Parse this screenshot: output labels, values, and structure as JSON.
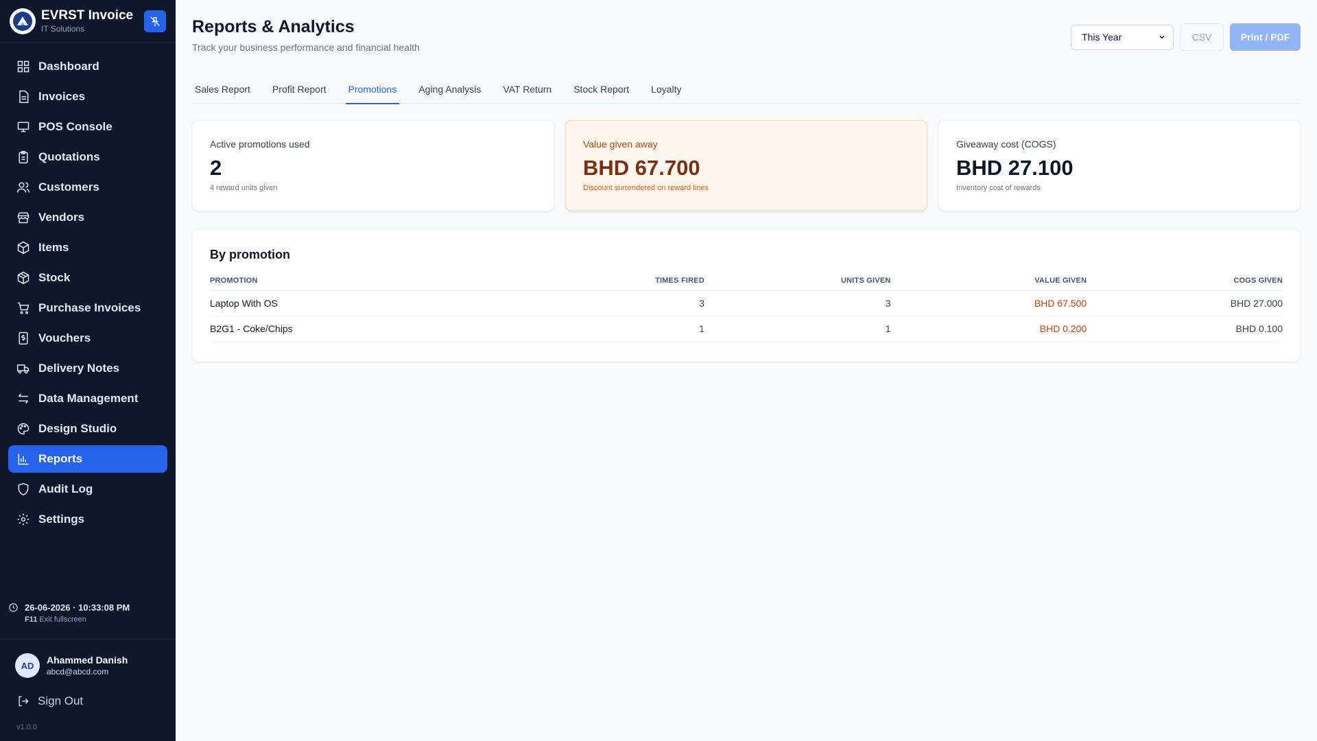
{
  "brand": {
    "title": "EVRST Invoice",
    "subtitle": "IT Solutions"
  },
  "nav": [
    {
      "label": "Dashboard",
      "icon": "dashboard-icon",
      "active": false
    },
    {
      "label": "Invoices",
      "icon": "file-icon",
      "active": false
    },
    {
      "label": "POS Console",
      "icon": "monitor-icon",
      "active": false
    },
    {
      "label": "Quotations",
      "icon": "clipboard-icon",
      "active": false
    },
    {
      "label": "Customers",
      "icon": "users-icon",
      "active": false
    },
    {
      "label": "Vendors",
      "icon": "store-icon",
      "active": false
    },
    {
      "label": "Items",
      "icon": "box-icon",
      "active": false
    },
    {
      "label": "Stock",
      "icon": "package-icon",
      "active": false
    },
    {
      "label": "Purchase Invoices",
      "icon": "cart-icon",
      "active": false
    },
    {
      "label": "Vouchers",
      "icon": "dollar-receipt-icon",
      "active": false
    },
    {
      "label": "Delivery Notes",
      "icon": "truck-icon",
      "active": false
    },
    {
      "label": "Data Management",
      "icon": "transfer-icon",
      "active": false
    },
    {
      "label": "Design Studio",
      "icon": "palette-icon",
      "active": false
    },
    {
      "label": "Reports",
      "icon": "bar-chart-icon",
      "active": true
    },
    {
      "label": "Audit Log",
      "icon": "shield-icon",
      "active": false
    },
    {
      "label": "Settings",
      "icon": "gear-icon",
      "active": false
    }
  ],
  "clock": {
    "datetime": "26-06-2026 · 10:33:08 PM",
    "key": "F11",
    "hint": "Exit fullscreen"
  },
  "user": {
    "initials": "AD",
    "name": "Ahammed Danish",
    "email": "abcd@abcd.com"
  },
  "signout": "Sign Out",
  "version": "v1.0.0",
  "header": {
    "title": "Reports & Analytics",
    "subtitle": "Track your business performance and financial health"
  },
  "toolbar": {
    "period": "This Year",
    "csv": "CSV",
    "print": "Print / PDF"
  },
  "tabs": [
    {
      "label": "Sales Report",
      "active": false
    },
    {
      "label": "Profit Report",
      "active": false
    },
    {
      "label": "Promotions",
      "active": true
    },
    {
      "label": "Aging Analysis",
      "active": false
    },
    {
      "label": "VAT Return",
      "active": false
    },
    {
      "label": "Stock Report",
      "active": false
    },
    {
      "label": "Loyalty",
      "active": false
    }
  ],
  "cards": [
    {
      "label": "Active promotions used",
      "value": "2",
      "note": "4 reward units given"
    },
    {
      "label": "Value given away",
      "value": "BHD 67.700",
      "note": "Discount surrendered on reward lines"
    },
    {
      "label": "Giveaway cost (COGS)",
      "value": "BHD 27.100",
      "note": "Inventory cost of rewards"
    }
  ],
  "table": {
    "title": "By promotion",
    "headers": [
      "PROMOTION",
      "TIMES FIRED",
      "UNITS GIVEN",
      "VALUE GIVEN",
      "COGS GIVEN"
    ],
    "rows": [
      [
        "Laptop With OS",
        "3",
        "3",
        "BHD 67.500",
        "BHD 27.000"
      ],
      [
        "B2G1 - Coke/Chips",
        "1",
        "1",
        "BHD 0.200",
        "BHD 0.100"
      ]
    ]
  },
  "colors": {
    "accent": "#2563eb",
    "sidebar": "#0f172a",
    "warn_bg": "#fff7ed",
    "warn_text": "#c2410c"
  }
}
